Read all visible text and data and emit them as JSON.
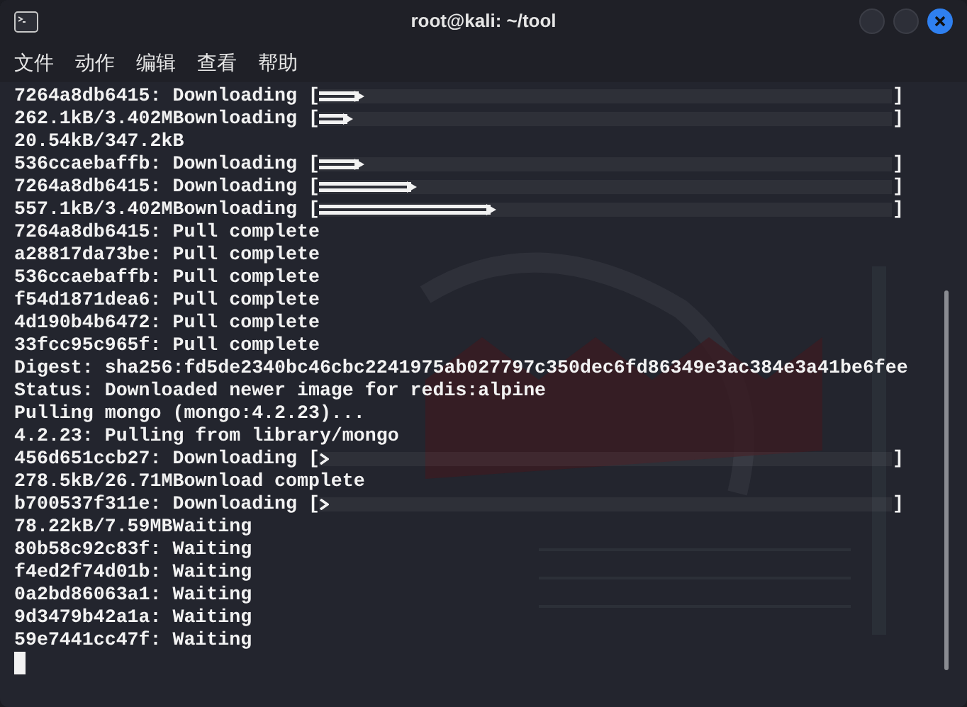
{
  "window": {
    "title": "root@kali: ~/tool"
  },
  "menu": [
    "文件",
    "动作",
    "编辑",
    "查看",
    "帮助"
  ],
  "terminal": {
    "lines": [
      {
        "kind": "progress",
        "text": "7264a8db6415: Downloading [",
        "level": 0.08,
        "end": "]"
      },
      {
        "kind": "progress",
        "text": "262.1kB/3.402MBownloading [",
        "level": 0.06,
        "end": "]"
      },
      {
        "kind": "text",
        "text": "20.54kB/347.2kB"
      },
      {
        "kind": "progress",
        "text": "536ccaebaffb: Downloading [",
        "level": 0.08,
        "end": "]"
      },
      {
        "kind": "progress",
        "text": "7264a8db6415: Downloading [",
        "level": 0.17,
        "end": "]"
      },
      {
        "kind": "progress",
        "text": "557.1kB/3.402MBownloading [",
        "level": 0.31,
        "end": "]"
      },
      {
        "kind": "text",
        "text": "7264a8db6415: Pull complete"
      },
      {
        "kind": "text",
        "text": "a28817da73be: Pull complete"
      },
      {
        "kind": "text",
        "text": "536ccaebaffb: Pull complete"
      },
      {
        "kind": "text",
        "text": "f54d1871dea6: Pull complete"
      },
      {
        "kind": "text",
        "text": "4d190b4b6472: Pull complete"
      },
      {
        "kind": "text",
        "text": "33fcc95c965f: Pull complete"
      },
      {
        "kind": "text",
        "text": "Digest: sha256:fd5de2340bc46cbc2241975ab027797c350dec6fd86349e3ac384e3a41be6fee"
      },
      {
        "kind": "text",
        "text": "Status: Downloaded newer image for redis:alpine"
      },
      {
        "kind": "text",
        "text": "Pulling mongo (mongo:4.2.23)..."
      },
      {
        "kind": "text",
        "text": "4.2.23: Pulling from library/mongo"
      },
      {
        "kind": "progress",
        "text": "456d651ccb27: Downloading [",
        "level": 0,
        "end": "]"
      },
      {
        "kind": "text",
        "text": "278.5kB/26.71MBownload complete"
      },
      {
        "kind": "progress",
        "text": "b700537f311e: Downloading [",
        "level": 0,
        "end": "]"
      },
      {
        "kind": "text",
        "text": "78.22kB/7.59MBWaiting"
      },
      {
        "kind": "text",
        "text": "80b58c92c83f: Waiting"
      },
      {
        "kind": "text",
        "text": "f4ed2f74d01b: Waiting"
      },
      {
        "kind": "text",
        "text": "0a2bd86063a1: Waiting"
      },
      {
        "kind": "text",
        "text": "9d3479b42a1a: Waiting"
      },
      {
        "kind": "text",
        "text": "59e7441cc47f: Waiting"
      },
      {
        "kind": "cursor"
      }
    ]
  }
}
